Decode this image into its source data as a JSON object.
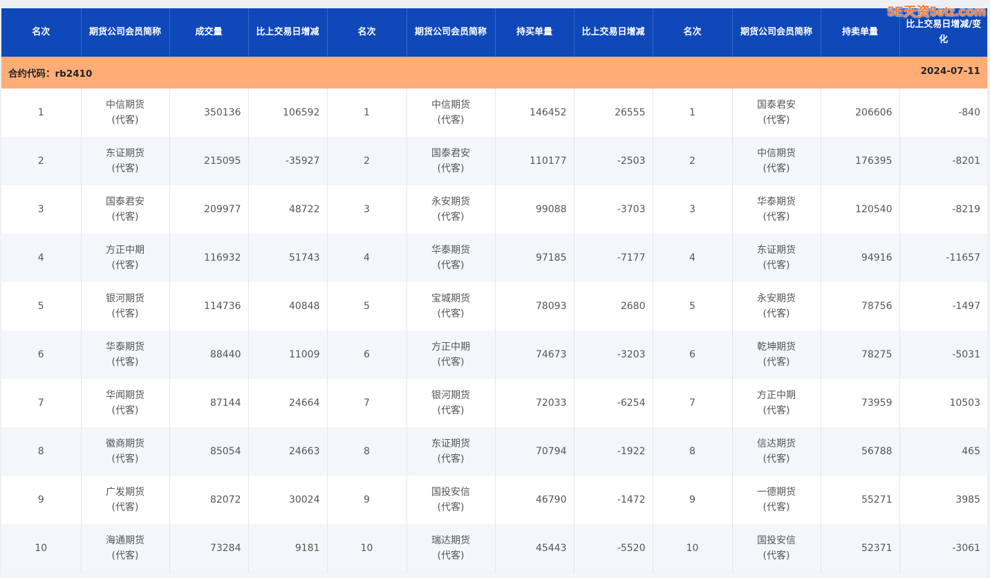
{
  "headers": [
    "名次",
    "期货公司会员简称",
    "成交量",
    "比上交易日增减",
    "名次",
    "期货公司会员简称",
    "持买单量",
    "比上交易日增减",
    "名次",
    "期货公司会员简称",
    "持卖单量",
    "比上交易日增减/变化"
  ],
  "contract": {
    "label": "合约代码：rb2410",
    "date": "2024-07-11"
  },
  "watermark": "5E天资5etz.com",
  "rows": [
    [
      "1",
      "中信期货",
      "(代客)",
      "350136",
      "106592",
      "1",
      "中信期货",
      "(代客)",
      "146452",
      "26555",
      "1",
      "国泰君安",
      "(代客)",
      "206606",
      "-840"
    ],
    [
      "2",
      "东证期货",
      "(代客)",
      "215095",
      "-35927",
      "2",
      "国泰君安",
      "(代客)",
      "110177",
      "-2503",
      "2",
      "中信期货",
      "(代客)",
      "176395",
      "-8201"
    ],
    [
      "3",
      "国泰君安",
      "(代客)",
      "209977",
      "48722",
      "3",
      "永安期货",
      "(代客)",
      "99088",
      "-3703",
      "3",
      "华泰期货",
      "(代客)",
      "120540",
      "-8219"
    ],
    [
      "4",
      "方正中期",
      "(代客)",
      "116932",
      "51743",
      "4",
      "华泰期货",
      "(代客)",
      "97185",
      "-7177",
      "4",
      "东证期货",
      "(代客)",
      "94916",
      "-11657"
    ],
    [
      "5",
      "银河期货",
      "(代客)",
      "114736",
      "40848",
      "5",
      "宝城期货",
      "(代客)",
      "78093",
      "2680",
      "5",
      "永安期货",
      "(代客)",
      "78756",
      "-1497"
    ],
    [
      "6",
      "华泰期货",
      "(代客)",
      "88440",
      "11009",
      "6",
      "方正中期",
      "(代客)",
      "74673",
      "-3203",
      "6",
      "乾坤期货",
      "(代客)",
      "78275",
      "-5031"
    ],
    [
      "7",
      "华闻期货",
      "(代客)",
      "87144",
      "24664",
      "7",
      "银河期货",
      "(代客)",
      "72033",
      "-6254",
      "7",
      "方正中期",
      "(代客)",
      "73959",
      "10503"
    ],
    [
      "8",
      "徽商期货",
      "(代客)",
      "85054",
      "24663",
      "8",
      "东证期货",
      "(代客)",
      "70794",
      "-1922",
      "8",
      "信达期货",
      "(代客)",
      "56788",
      "465"
    ],
    [
      "9",
      "广发期货",
      "(代客)",
      "82072",
      "30024",
      "9",
      "国投安信",
      "(代客)",
      "46790",
      "-1472",
      "9",
      "一德期货",
      "(代客)",
      "55271",
      "3985"
    ],
    [
      "10",
      "海通期货",
      "(代客)",
      "73284",
      "9181",
      "10",
      "瑞达期货",
      "(代客)",
      "45443",
      "-5520",
      "10",
      "国投安信",
      "(代客)",
      "52371",
      "-3061"
    ]
  ]
}
